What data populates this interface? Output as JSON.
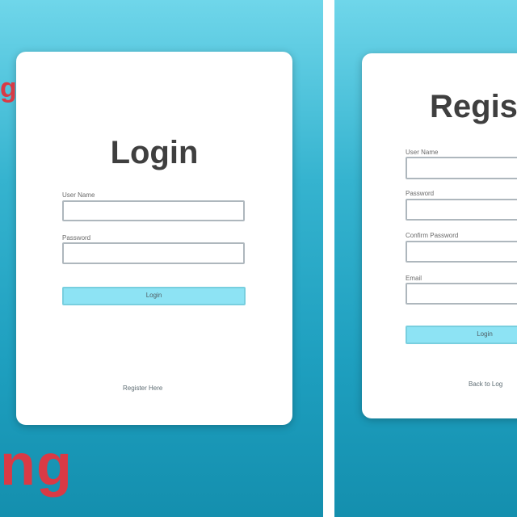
{
  "overlay": {
    "top_fragment": "g",
    "bottom_fragment": "ng"
  },
  "login_card": {
    "title": "Login",
    "username_label": "User Name",
    "password_label": "Password",
    "username_value": "",
    "password_value": "",
    "submit_label": "Login",
    "register_link": "Register Here"
  },
  "register_card": {
    "title": "Regis",
    "username_label": "User Name",
    "password_label": "Password",
    "confirm_password_label": "Confirm Password",
    "email_label": "Email",
    "username_value": "",
    "password_value": "",
    "confirm_password_value": "",
    "email_value": "",
    "submit_label": "Login",
    "back_link": "Back to Log"
  }
}
